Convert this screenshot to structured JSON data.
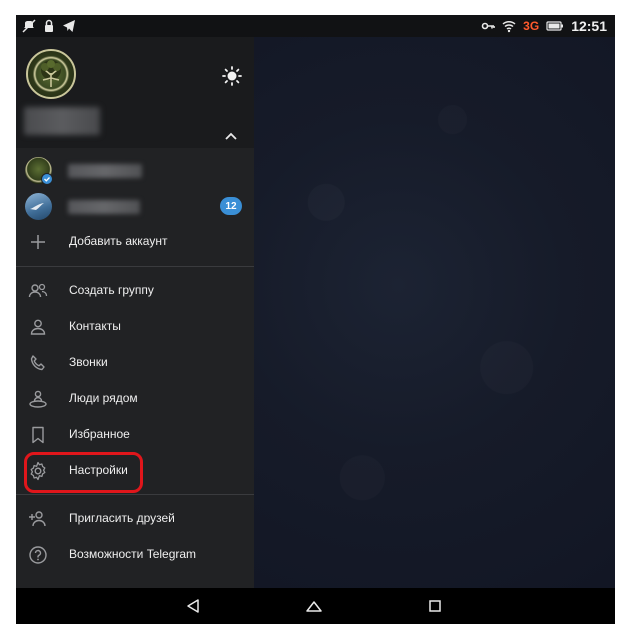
{
  "status_bar": {
    "left_icons": [
      "no-notifications-icon",
      "lock-icon",
      "telegram-send-icon"
    ],
    "right_icons": [
      "key-icon",
      "wifi-icon",
      "battery-icon"
    ],
    "network": "3G",
    "time": "12:51"
  },
  "drawer": {
    "accounts": [
      {
        "name": "",
        "avatar": "tree-avatar",
        "verified": true
      },
      {
        "name": "",
        "avatar": "bird-avatar",
        "unread": "12"
      }
    ],
    "add_account": "Добавить аккаунт",
    "menu": [
      {
        "icon": "group-icon",
        "label": "Создать группу"
      },
      {
        "icon": "contact-icon",
        "label": "Контакты"
      },
      {
        "icon": "phone-icon",
        "label": "Звонки"
      },
      {
        "icon": "people-nearby-icon",
        "label": "Люди рядом"
      },
      {
        "icon": "bookmark-icon",
        "label": "Избранное"
      },
      {
        "icon": "gear-icon",
        "label": "Настройки"
      }
    ],
    "secondary_menu": [
      {
        "icon": "add-user-icon",
        "label": "Пригласить друзей"
      },
      {
        "icon": "help-icon",
        "label": "Возможности Telegram"
      }
    ]
  },
  "colors": {
    "drawer_bg": "#212224",
    "header_bg": "#1a1b1d",
    "badge": "#3a8fd6",
    "highlight": "#e0161b",
    "network_3g": "#ff5a2d"
  }
}
